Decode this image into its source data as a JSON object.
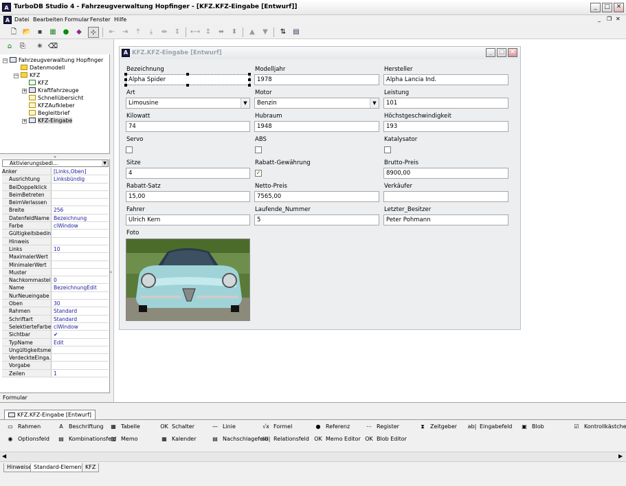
{
  "window": {
    "title": "TurboDB Studio 4 - Fahrzeugverwaltung Hopfinger - [KFZ.KFZ-Eingabe [Entwurf]]",
    "icon_letter": "A"
  },
  "menu": [
    "Datei",
    "Bearbeiten",
    "Formular",
    "Fenster",
    "Hilfe"
  ],
  "tree": {
    "root": "Fahrzeugverwaltung Hopfinger",
    "items": [
      "Datenmodell",
      "KFZ",
      "KFZ",
      "Kraftfahrzeuge",
      "Schnellübersicht",
      "KFZAufkleber",
      "Begleitbrief",
      "KFZ-Eingabe"
    ]
  },
  "props": {
    "header": "Aktivierungsbedi...",
    "rows": [
      [
        "Anker",
        "[Links,Oben]"
      ],
      [
        "Ausrichtung",
        "Linksbündig"
      ],
      [
        "BeiDoppelklick",
        ""
      ],
      [
        "BeimBetreten",
        ""
      ],
      [
        "BeimVerlassen",
        ""
      ],
      [
        "Breite",
        "256"
      ],
      [
        "DatenfeldName",
        "Bezeichnung"
      ],
      [
        "Farbe",
        "clWindow"
      ],
      [
        "Gültigkeitsbedin...",
        ""
      ],
      [
        "Hinweis",
        ""
      ],
      [
        "Links",
        "10"
      ],
      [
        "MaximalerWert",
        ""
      ],
      [
        "MinimalerWert",
        ""
      ],
      [
        "Muster",
        ""
      ],
      [
        "Nachkommastell...",
        "0"
      ],
      [
        "Name",
        "BezeichnungEdit"
      ],
      [
        "NurNeueingabe",
        ""
      ],
      [
        "Oben",
        "30"
      ],
      [
        "Rahmen",
        "Standard"
      ],
      [
        "Schriftart",
        "Standard"
      ],
      [
        "SelektierteFarbe",
        "clWindow"
      ],
      [
        "Sichtbar",
        "✔"
      ],
      [
        "TypName",
        "Edit"
      ],
      [
        "Ungültigkeitsmel...",
        ""
      ],
      [
        "VerdeckteEinga...",
        ""
      ],
      [
        "Vorgabe",
        ""
      ],
      [
        "Zeilen",
        "1"
      ]
    ],
    "formular_label": "Formular"
  },
  "form": {
    "title": "KFZ.KFZ-Eingabe [Entwurf]",
    "fields": {
      "bezeichnung": {
        "label": "Bezeichnung",
        "value": "Alpha Spider"
      },
      "modelljahr": {
        "label": "Modelljahr",
        "value": "1978"
      },
      "hersteller": {
        "label": "Hersteller",
        "value": "Alpha Lancia Ind."
      },
      "art": {
        "label": "Art",
        "value": "Limousine"
      },
      "motor": {
        "label": "Motor",
        "value": "Benzin"
      },
      "leistung": {
        "label": "Leistung",
        "value": "101"
      },
      "kilowatt": {
        "label": "Kilowatt",
        "value": "74"
      },
      "hubraum": {
        "label": "Hubraum",
        "value": "1948"
      },
      "hoechst": {
        "label": "Höchstgeschwindigkeit",
        "value": "193"
      },
      "servo": {
        "label": "Servo"
      },
      "abs": {
        "label": "ABS"
      },
      "kat": {
        "label": "Katalysator"
      },
      "sitze": {
        "label": "Sitze",
        "value": "4"
      },
      "rabattgew": {
        "label": "Rabatt-Gewährung"
      },
      "brutto": {
        "label": "Brutto-Preis",
        "value": "8900,00"
      },
      "rabattsatz": {
        "label": "Rabatt-Satz",
        "value": "15,00"
      },
      "netto": {
        "label": "Netto-Preis",
        "value": "7565,00"
      },
      "verkaeufer": {
        "label": "Verkäufer",
        "value": ""
      },
      "fahrer": {
        "label": "Fahrer",
        "value": "Ulrich Kern"
      },
      "laufende": {
        "label": "Laufende_Nummer",
        "value": "5"
      },
      "letzter": {
        "label": "Letzter_Besitzer",
        "value": "Peter Pohmann"
      },
      "foto": {
        "label": "Foto"
      }
    }
  },
  "doc_tab": "KFZ.KFZ-Eingabe [Entwurf]",
  "palette": [
    [
      "Rahmen",
      "Beschriftung",
      "Tabelle",
      "Schalter",
      "Linie",
      "Formel",
      "Referenz",
      "Register",
      "Zeitgeber",
      "Eingabefeld",
      "Blob",
      "Kontrollkästchen"
    ],
    [
      "Optionsfeld",
      "Kombinationsfeld",
      "Memo",
      "Kalender",
      "Nachschlagefeld",
      "Relationsfeld",
      "Memo Editor",
      "Blob Editor"
    ]
  ],
  "bottom_tabs": [
    "Hinweise",
    "Standard-Elemente",
    "KFZ"
  ]
}
